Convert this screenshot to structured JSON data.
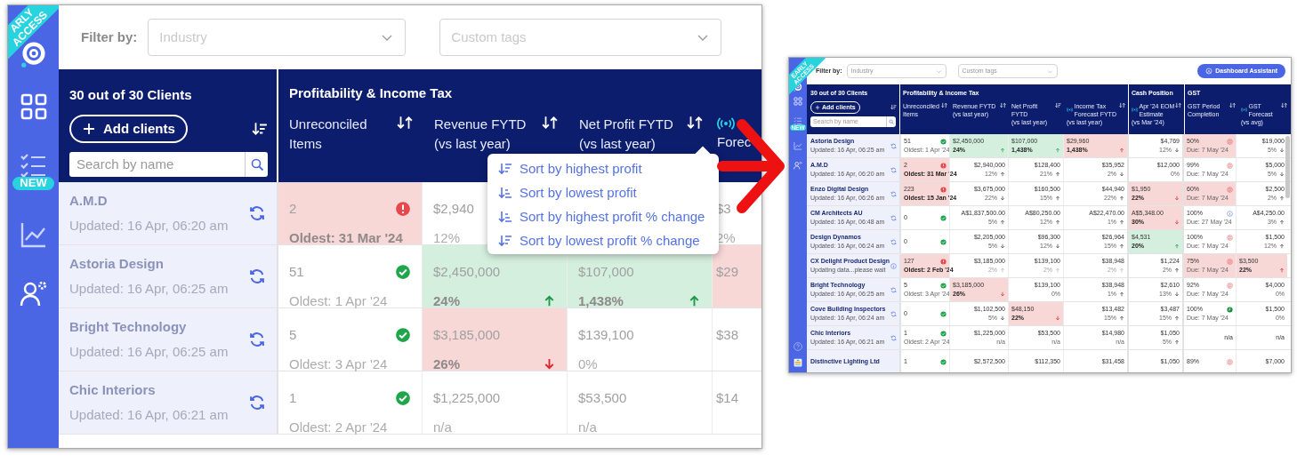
{
  "zoom_view": {
    "ribbon_lines": [
      "ARLY",
      "ACCESS"
    ],
    "sidebar": [
      {
        "kind": "grid"
      },
      {
        "kind": "checklist",
        "badge": "NEW"
      },
      {
        "kind": "chart"
      },
      {
        "kind": "users"
      }
    ],
    "filter_label": "Filter by:",
    "filters": [
      {
        "placeholder": "Industry"
      },
      {
        "placeholder": "Custom tags"
      }
    ],
    "clients_title": "30 out of 30 Clients",
    "add_button": "Add clients",
    "search_placeholder": "Search by name",
    "groups": [
      {
        "title": "Profitability & Income Tax",
        "columns": [
          {
            "label": "Unreconciled Items",
            "sortable": true,
            "sorted": false,
            "live": false
          },
          {
            "label": "Revenue FYTD",
            "sub": "(vs last year)",
            "sortable": true,
            "sorted": false,
            "live": false
          },
          {
            "label": "Net Profit FYTD",
            "sub": "(vs last year)",
            "sortable": true,
            "sorted": false,
            "live": false
          },
          {
            "label": "Forec",
            "sortable": false,
            "live": true
          }
        ]
      }
    ],
    "sort_menu": [
      {
        "label": "Sort by highest profit",
        "kind": "desc"
      },
      {
        "label": "Sort by lowest profit",
        "kind": "asc"
      },
      {
        "label": "Sort by highest profit % change",
        "kind": "asc"
      },
      {
        "label": "Sort by lowest profit % change",
        "kind": "desc"
      }
    ],
    "rows": [
      {
        "name": "A.M.D",
        "updated": "Updated: 16 Apr, 06:20 am",
        "syncing": false,
        "cells": [
          {
            "kind": "alert",
            "value": "2",
            "note": "Oldest: 31 Mar '24",
            "color": "#f8d7d7"
          },
          {
            "kind": "number",
            "value": "$2,940",
            "note": "12%"
          },
          {},
          {
            "kind": "number",
            "value": "$3",
            "note": "2%"
          }
        ]
      },
      {
        "name": "Astoria Design",
        "updated": "Updated: 16 Apr, 06:25 am",
        "syncing": false,
        "cells": [
          {
            "kind": "ok",
            "value": "51",
            "note": "Oldest: 1 Apr '24"
          },
          {
            "kind": "number",
            "value": "$2,450,000",
            "note": "24%",
            "rising": true,
            "color": "#d5efdf"
          },
          {
            "kind": "number",
            "value": "$107,000",
            "note": "1,438%",
            "rising": true,
            "color": "#d5efdf"
          },
          {
            "kind": "number",
            "value": "$29",
            "color": "#f8d7d7"
          }
        ]
      },
      {
        "name": "Bright Technology",
        "updated": "Updated: 16 Apr, 06:25 am",
        "syncing": false,
        "cells": [
          {
            "kind": "ok",
            "value": "5",
            "note": "Oldest: 3 Apr '24"
          },
          {
            "kind": "number",
            "value": "$3,185,000",
            "note": "26%",
            "rising": false,
            "color": "#f8d7d7"
          },
          {
            "kind": "number",
            "value": "$139,100",
            "note": "0%"
          },
          {
            "kind": "number",
            "value": "$38"
          }
        ]
      },
      {
        "name": "Chic Interiors",
        "updated": "Updated: 16 Apr, 06:21 am",
        "syncing": false,
        "cells": [
          {
            "kind": "ok",
            "value": "1",
            "note": "Oldest: 2 Apr '24"
          },
          {
            "kind": "number",
            "value": "$1,225,000",
            "note": "n/a"
          },
          {
            "kind": "number",
            "value": "$53,500",
            "note": "n/a"
          },
          {
            "kind": "number",
            "value": "$14"
          }
        ]
      }
    ]
  },
  "dashboard": {
    "ribbon_lines": [
      "EARLY",
      "ACCESS"
    ],
    "sidebar": [
      {
        "kind": "grid"
      },
      {
        "kind": "checklist",
        "badge": "NEW"
      },
      {
        "kind": "chart"
      },
      {
        "kind": "users"
      }
    ],
    "sidebar_bottom": [
      {
        "kind": "help"
      },
      {
        "kind": "app"
      }
    ],
    "filter_label": "Filter by:",
    "filters": [
      {
        "placeholder": "Industry"
      },
      {
        "placeholder": "Custom tags"
      }
    ],
    "assistant_button": "Dashboard Assistant",
    "clients_title": "30 out of 30 Clients",
    "add_button": "Add clients",
    "search_placeholder": "Search by name",
    "groups": [
      {
        "title": "Profitability & Income Tax",
        "columns": [
          {
            "label": "Unreconciled Items",
            "sortable": true,
            "sorted": false,
            "live": false
          },
          {
            "label": "Revenue FYTD",
            "sub": "(vs last year)",
            "sortable": true,
            "sorted": false,
            "live": false
          },
          {
            "label": "Net Profit FYTD",
            "sub": "(vs last year)",
            "sortable": true,
            "sorted": true,
            "live": false
          },
          {
            "label": "Income Tax Forecast FYTD",
            "sub": "(vs last year)",
            "sortable": true,
            "sorted": false,
            "live": true
          }
        ]
      },
      {
        "title": "Cash Position",
        "columns": [
          {
            "label": "Apr '24 EOM Estimate",
            "sub": "(vs Mar '24)",
            "sortable": true,
            "sorted": false,
            "live": true
          }
        ]
      },
      {
        "title": "GST",
        "columns": [
          {
            "label": "GST Period Completion",
            "sortable": true,
            "sorted": false,
            "live": false
          },
          {
            "label": "GST Forecast",
            "sub": "(vs avg)",
            "sortable": true,
            "sorted": false,
            "live": true
          }
        ]
      }
    ],
    "rows": [
      {
        "name": "Astoria Design",
        "updated": "Updated: 16 Apr, 06:25 am",
        "syncing": false,
        "cells": [
          {
            "kind": "ok",
            "value": "51",
            "note": "Oldest: 1 Apr '24"
          },
          {
            "kind": "number",
            "value": "$2,450,000",
            "note": "24%",
            "rising": true,
            "color": "#d5efdf"
          },
          {
            "kind": "number",
            "value": "$107,000",
            "note": "1,438%",
            "rising": true,
            "color": "#d5efdf"
          },
          {
            "kind": "number",
            "value": "$29,960",
            "note": "1,438%",
            "rising": true,
            "color": "#f8d7d7"
          },
          {
            "kind": "number",
            "value": "$4,769",
            "note": "12%",
            "rising": false
          },
          {
            "kind": "due",
            "value": "50%",
            "note": "Due: 7 May '24",
            "color": "#f8d7d7"
          },
          {
            "kind": "number",
            "value": "$19,000",
            "note": "5%",
            "rising": false
          }
        ]
      },
      {
        "name": "A.M.D",
        "updated": "Updated: 16 Apr, 06:20 am",
        "syncing": false,
        "cells": [
          {
            "kind": "alert",
            "value": "2",
            "note": "Oldest: 31 Mar '24",
            "color": "#f8d7d7"
          },
          {
            "kind": "number",
            "value": "$2,940,000",
            "note": "12%",
            "rising": true
          },
          {
            "kind": "number",
            "value": "$128,400",
            "note": "21%",
            "rising": true
          },
          {
            "kind": "number",
            "value": "$35,952",
            "note": "2%",
            "rising": false
          },
          {
            "kind": "number",
            "value": "$12,000",
            "note": "0%"
          },
          {
            "kind": "due",
            "value": "99%",
            "note": "Due: 7 May '24"
          },
          {
            "kind": "number",
            "value": "$5,000",
            "note": "5%",
            "rising": false
          }
        ]
      },
      {
        "name": "Enzo Digital Design",
        "updated": "Updated: 16 Apr, 06:26 am",
        "syncing": false,
        "cells": [
          {
            "kind": "alert",
            "value": "223",
            "note": "Oldest: 15 Jan '24",
            "color": "#f8d7d7"
          },
          {
            "kind": "number",
            "value": "$3,675,000",
            "note": "22%",
            "rising": false
          },
          {
            "kind": "number",
            "value": "$160,500",
            "note": "15%",
            "rising": true
          },
          {
            "kind": "number",
            "value": "$44,940",
            "note": "22%",
            "rising": true
          },
          {
            "kind": "number",
            "value": "$1,950",
            "note": "22%",
            "rising": false,
            "color": "#f8d7d7"
          },
          {
            "kind": "due",
            "value": "60%",
            "note": "Due: 7 May '24",
            "color": "#f8d7d7"
          },
          {
            "kind": "number",
            "value": "$2,500",
            "note": "2%",
            "rising": true
          }
        ]
      },
      {
        "name": "CM Architects AU",
        "updated": "Updated: 16 Apr, 06:48 am",
        "syncing": false,
        "cells": [
          {
            "kind": "ok",
            "value": "0"
          },
          {
            "kind": "number",
            "value": "A$1,837,500.00",
            "note": "5%",
            "rising": true
          },
          {
            "kind": "number",
            "value": "A$80,250.00",
            "note": "12%",
            "rising": true
          },
          {
            "kind": "number",
            "value": "A$22,470.00",
            "note": "1%",
            "rising": true
          },
          {
            "kind": "number",
            "value": "A$5,348.00",
            "note": "30%",
            "rising": false,
            "color": "#f8d7d7"
          },
          {
            "kind": "info",
            "value": "100%",
            "note": "Due: 27 May '24"
          },
          {
            "kind": "number",
            "value": "A$4,250.00",
            "note": "3%",
            "rising": true
          }
        ]
      },
      {
        "name": "Design Dynamos",
        "updated": "Updated: 16 Apr, 06:24 am",
        "syncing": false,
        "cells": [
          {
            "kind": "ok",
            "value": "0"
          },
          {
            "kind": "number",
            "value": "$2,205,000",
            "note": "5%",
            "rising": false
          },
          {
            "kind": "number",
            "value": "$96,300",
            "note": "12%",
            "rising": false
          },
          {
            "kind": "number",
            "value": "$26,964",
            "note": "15%",
            "rising": true
          },
          {
            "kind": "number",
            "value": "$4,531",
            "note": "20%",
            "rising": true,
            "color": "#d5efdf"
          },
          {
            "kind": "due",
            "value": "100%",
            "note": "Due: 7 May '24"
          },
          {
            "kind": "number",
            "value": "$1,500",
            "note": "12%",
            "rising": true
          }
        ]
      },
      {
        "name": "CX Delight Product Design",
        "updated": "Updating data...please wait",
        "syncing": true,
        "cells": [
          {
            "kind": "alert",
            "value": "127",
            "note": "Oldest: 2 Feb '24",
            "color": "#f8d7d7"
          },
          {
            "kind": "number",
            "value": "$3,185,000",
            "note": "2%",
            "rising": true,
            "dimmed": true
          },
          {
            "kind": "number",
            "value": "$139,100",
            "note": "2%",
            "rising": true,
            "dimmed": true
          },
          {
            "kind": "number",
            "value": "$38,948",
            "note": "2%",
            "rising": true,
            "dimmed": true
          },
          {
            "kind": "number",
            "value": "$1,224",
            "note": "2%",
            "rising": true
          },
          {
            "kind": "due",
            "value": "75%",
            "note": "Due: 7 May '24",
            "color": "#f8d7d7"
          },
          {
            "kind": "number",
            "value": "$3,500",
            "note": "22%",
            "rising": true,
            "color": "#f8d7d7"
          }
        ]
      },
      {
        "name": "Bright Technology",
        "updated": "Updated: 16 Apr, 06:25 am",
        "syncing": false,
        "cells": [
          {
            "kind": "ok",
            "value": "5",
            "note": "Oldest: 3 Apr '24"
          },
          {
            "kind": "number",
            "value": "$3,185,000",
            "note": "26%",
            "rising": false,
            "color": "#f8d7d7"
          },
          {
            "kind": "number",
            "value": "$139,100",
            "note": "0%"
          },
          {
            "kind": "number",
            "value": "$38,948",
            "note": "1%",
            "rising": true
          },
          {
            "kind": "number",
            "value": "$2,610",
            "note": "13%",
            "rising": false
          },
          {
            "kind": "due",
            "value": "92%",
            "note": "Due: 7 May '24"
          },
          {
            "kind": "number",
            "value": "$4,000",
            "note": "0%"
          }
        ]
      },
      {
        "name": "Cove Building Inspectors",
        "updated": "Updated: 16 Apr, 06:24 am",
        "syncing": false,
        "cells": [
          {
            "kind": "ok",
            "value": "0"
          },
          {
            "kind": "number",
            "value": "$1,102,500",
            "note": "5%",
            "rising": false
          },
          {
            "kind": "number",
            "value": "$48,150",
            "note": "22%",
            "rising": false,
            "color": "#f8d7d7"
          },
          {
            "kind": "number",
            "value": "$13,482",
            "note": "15%",
            "rising": true
          },
          {
            "kind": "number",
            "value": "$3,487",
            "note": "15%",
            "rising": true
          },
          {
            "kind": "done",
            "value": "100%",
            "note": "Due: 7 May '24"
          },
          {
            "kind": "number",
            "value": "$1,500",
            "note": "0%"
          }
        ]
      },
      {
        "name": "Chic Interiors",
        "updated": "Updated: 16 Apr, 06:21 am",
        "syncing": false,
        "cells": [
          {
            "kind": "ok",
            "value": "1",
            "note": "Oldest: 2 Apr '24"
          },
          {
            "kind": "number",
            "value": "$1,225,000",
            "note": "n/a"
          },
          {
            "kind": "number",
            "value": "$53,500",
            "note": "n/a"
          },
          {
            "kind": "number",
            "value": "$14,980",
            "note": "n/a"
          },
          {
            "kind": "number",
            "value": "$1,050",
            "note": "5%",
            "rising": true
          },
          {
            "kind": "number",
            "value": "n/a"
          },
          {
            "kind": "number",
            "value": "n/a"
          }
        ]
      },
      {
        "name": "Distinctive Lighting Ltd",
        "cells": [
          {
            "kind": "ok",
            "value": "1"
          },
          {
            "kind": "number",
            "value": "$2,572,500"
          },
          {
            "kind": "number",
            "value": "$112,350"
          },
          {
            "kind": "number",
            "value": "$31,458"
          },
          {
            "kind": "number",
            "value": "$1,050"
          },
          {
            "kind": "due",
            "value": "89%"
          },
          {
            "kind": "number",
            "value": "$7,000"
          }
        ]
      }
    ]
  }
}
